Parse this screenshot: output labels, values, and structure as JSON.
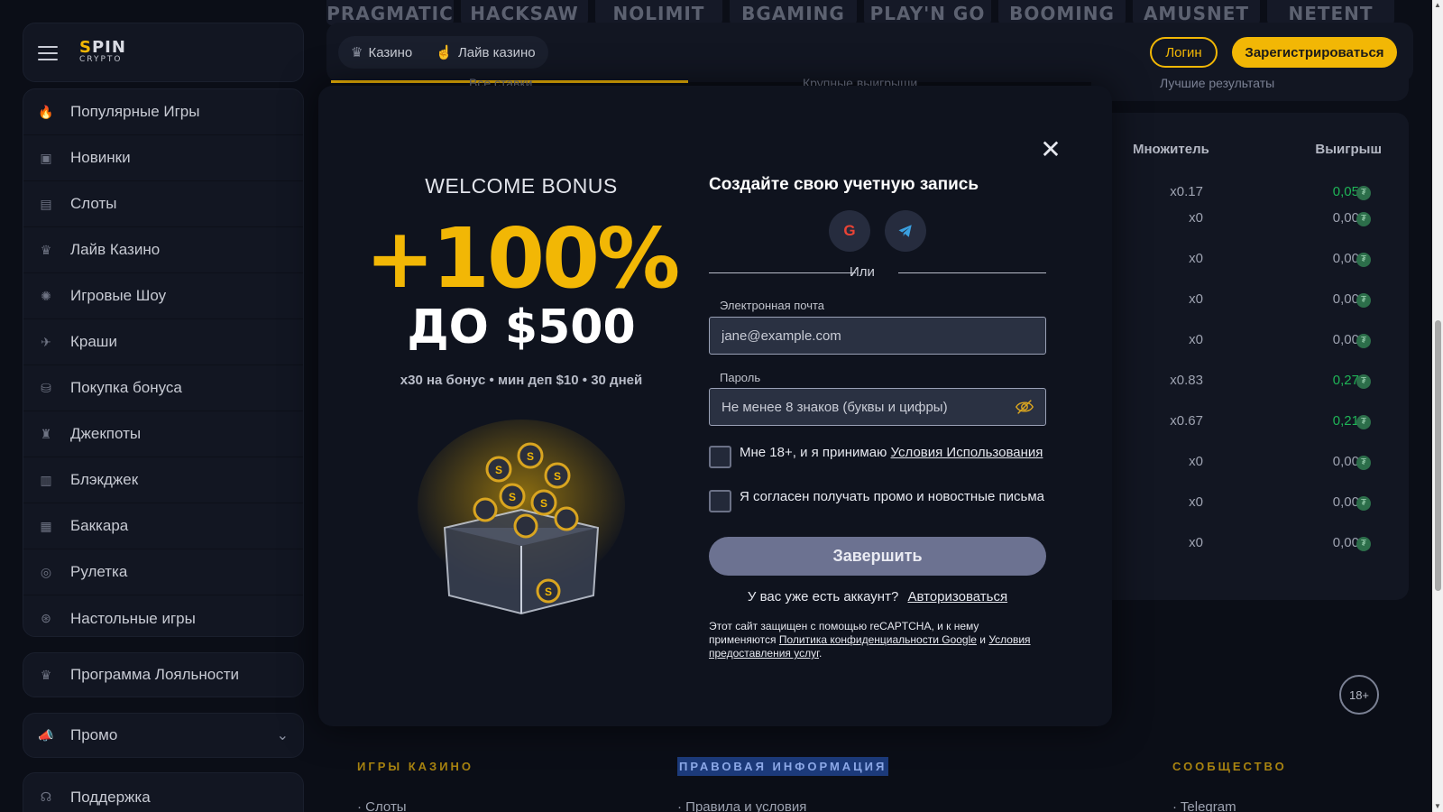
{
  "brand": {
    "logo_line1_a": "S",
    "logo_line1_b": "PIN",
    "logo_line2": "CRYPTO"
  },
  "providers": [
    "PRAGMATIC",
    "HACKSAW",
    "NOLIMIT",
    "BGAMING",
    "PLAY'N GO",
    "BOOMING",
    "AMUSNET",
    "NETENT"
  ],
  "header": {
    "tabs": [
      {
        "label": "Казино",
        "icon": "casino-icon"
      },
      {
        "label": "Лайв казино",
        "icon": "live-casino-icon"
      }
    ],
    "login_label": "Логин",
    "register_label": "Зарегистрироваться"
  },
  "sidebar": {
    "items": [
      {
        "label": "Популярные Игры",
        "icon": "fire-icon",
        "glyph": "🔥"
      },
      {
        "label": "Новинки",
        "icon": "new-icon",
        "glyph": "▣"
      },
      {
        "label": "Слоты",
        "icon": "slots-icon",
        "glyph": "▤"
      },
      {
        "label": "Лайв Казино",
        "icon": "live-icon",
        "glyph": "♛"
      },
      {
        "label": "Игровые Шоу",
        "icon": "wheel-icon",
        "glyph": "✺"
      },
      {
        "label": "Краши",
        "icon": "plane-icon",
        "glyph": "✈"
      },
      {
        "label": "Покупка бонуса",
        "icon": "coins-icon",
        "glyph": "⛁"
      },
      {
        "label": "Джекпоты",
        "icon": "jackpot-icon",
        "glyph": "♜"
      },
      {
        "label": "Блэкджек",
        "icon": "cards-icon",
        "glyph": "▥"
      },
      {
        "label": "Баккара",
        "icon": "baccarat-icon",
        "glyph": "▦"
      },
      {
        "label": "Рулетка",
        "icon": "roulette-icon",
        "glyph": "◎"
      },
      {
        "label": "Настольные игры",
        "icon": "table-games-icon",
        "glyph": "⊛"
      }
    ],
    "loyalty_label": "Программа Лояльности",
    "promo_label": "Промо",
    "support_label": "Поддержка"
  },
  "background": {
    "tab_left": "Все ставки",
    "tab_right": "Крупные выигрыши",
    "results_tab": "Лучшие результаты",
    "table": {
      "headers": [
        "Множитель",
        "Выигрыш"
      ],
      "rows": [
        {
          "mult": "x0.17",
          "win": "0,05",
          "positive": true
        },
        {
          "mult": "x0",
          "win": "0,00",
          "positive": false
        },
        {
          "mult": "x0",
          "win": "0,00",
          "positive": false
        },
        {
          "mult": "x0",
          "win": "0,00",
          "positive": false
        },
        {
          "mult": "x0",
          "win": "0,00",
          "positive": false
        },
        {
          "mult": "x0.83",
          "win": "0,27",
          "positive": true
        },
        {
          "mult": "x0.67",
          "win": "0,21",
          "positive": true
        },
        {
          "mult": "x0",
          "win": "0,00",
          "positive": false
        },
        {
          "mult": "x0",
          "win": "0,00",
          "positive": false
        },
        {
          "mult": "x0",
          "win": "0,00",
          "positive": false
        }
      ]
    },
    "age_badge": "18+",
    "footer": {
      "col1_title": "ИГРЫ КАЗИНО",
      "col1_link": "Слоты",
      "col2_title": "ПРАВОВАЯ ИНФОРМАЦИЯ",
      "col2_link": "Правила и условия",
      "col3_title": "СООБЩЕСТВО",
      "col3_link": "Telegram"
    }
  },
  "modal": {
    "welcome_title": "WELCOME BONUS",
    "bonus_percent": "+100%",
    "bonus_upto": "ДО $500",
    "bonus_terms": "x30 на бонус • мин деп $10 • 30 дней",
    "form_title": "Создайте свою учетную запись",
    "or_label": "Или",
    "email_label": "Электронная почта",
    "email_value": "jane@example.com",
    "password_label": "Пароль",
    "password_placeholder": "Не менее 8 знаков (буквы и цифры)",
    "age_consent_text": "Мне 18+, и я принимаю",
    "age_consent_link": "Условия Использования",
    "promo_consent_text": "Я согласен получать промо и новостные письма",
    "submit_label": "Завершить",
    "have_account_text": "У вас уже есть аккаунт?",
    "login_link": "Авторизоваться",
    "recaptcha_text": "Этот сайт защищен с помощью reCAPTCHA, и к нему применяются",
    "recaptcha_privacy_link": "Политика конфиденциальности Google",
    "recaptcha_and": "и",
    "recaptcha_terms_link": "Условия предоставления услуг",
    "recaptcha_end": "."
  },
  "colors": {
    "accent": "#f2b705",
    "positive": "#1fb457",
    "bg": "#0b0e17",
    "panel": "#121622"
  }
}
